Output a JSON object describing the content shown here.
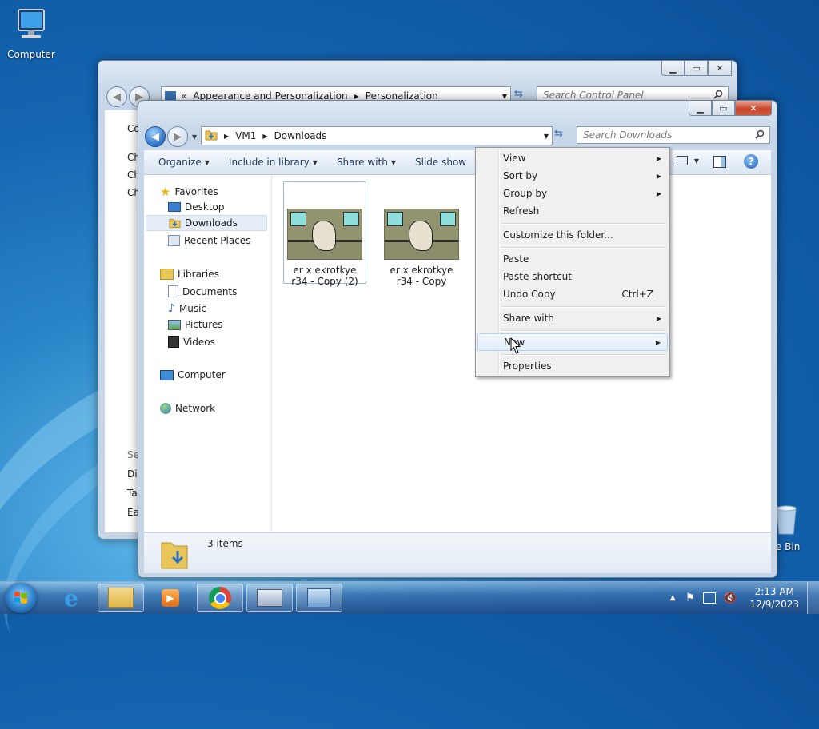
{
  "desktop": {
    "icons": [
      {
        "label": "Computer"
      },
      {
        "label": "cle Bin"
      }
    ]
  },
  "bg_window": {
    "address": {
      "prefix": "«",
      "crumbs": [
        "Appearance and Personalization",
        "Personalization"
      ]
    },
    "search_placeholder": "Search Control Panel",
    "partial_texts": [
      "Co",
      "Ch",
      "Ch",
      "Ch",
      "Se",
      "Dis",
      "Ta",
      "Ea"
    ]
  },
  "explorer": {
    "address": {
      "crumbs": [
        "VM1",
        "Downloads"
      ]
    },
    "search_placeholder": "Search Downloads",
    "toolbar": [
      {
        "label": "Organize",
        "caret": true
      },
      {
        "label": "Include in library",
        "caret": true
      },
      {
        "label": "Share with",
        "caret": true
      },
      {
        "label": "Slide show",
        "caret": false
      }
    ],
    "nav": {
      "favorites": "Favorites",
      "favorites_items": [
        "Desktop",
        "Downloads",
        "Recent Places"
      ],
      "libraries": "Libraries",
      "libraries_items": [
        "Documents",
        "Music",
        "Pictures",
        "Videos"
      ],
      "computer": "Computer",
      "network": "Network"
    },
    "files": [
      {
        "name": "er x ekrotkye r34 - Copy (2)"
      },
      {
        "name": "er x ekrotkye r34 - Copy"
      }
    ],
    "status": "3 items"
  },
  "context_menu": {
    "items": [
      {
        "label": "View",
        "submenu": true
      },
      {
        "label": "Sort by",
        "submenu": true
      },
      {
        "label": "Group by",
        "submenu": true
      },
      {
        "label": "Refresh"
      },
      {
        "label": "Customize this folder..."
      },
      {
        "label": "Paste"
      },
      {
        "label": "Paste shortcut"
      },
      {
        "label": "Undo Copy",
        "shortcut": "Ctrl+Z"
      },
      {
        "label": "Share with",
        "submenu": true
      },
      {
        "label": "New",
        "submenu": true
      },
      {
        "label": "Properties"
      }
    ]
  },
  "taskbar": {
    "time": "2:13 AM",
    "date": "12/9/2023"
  }
}
